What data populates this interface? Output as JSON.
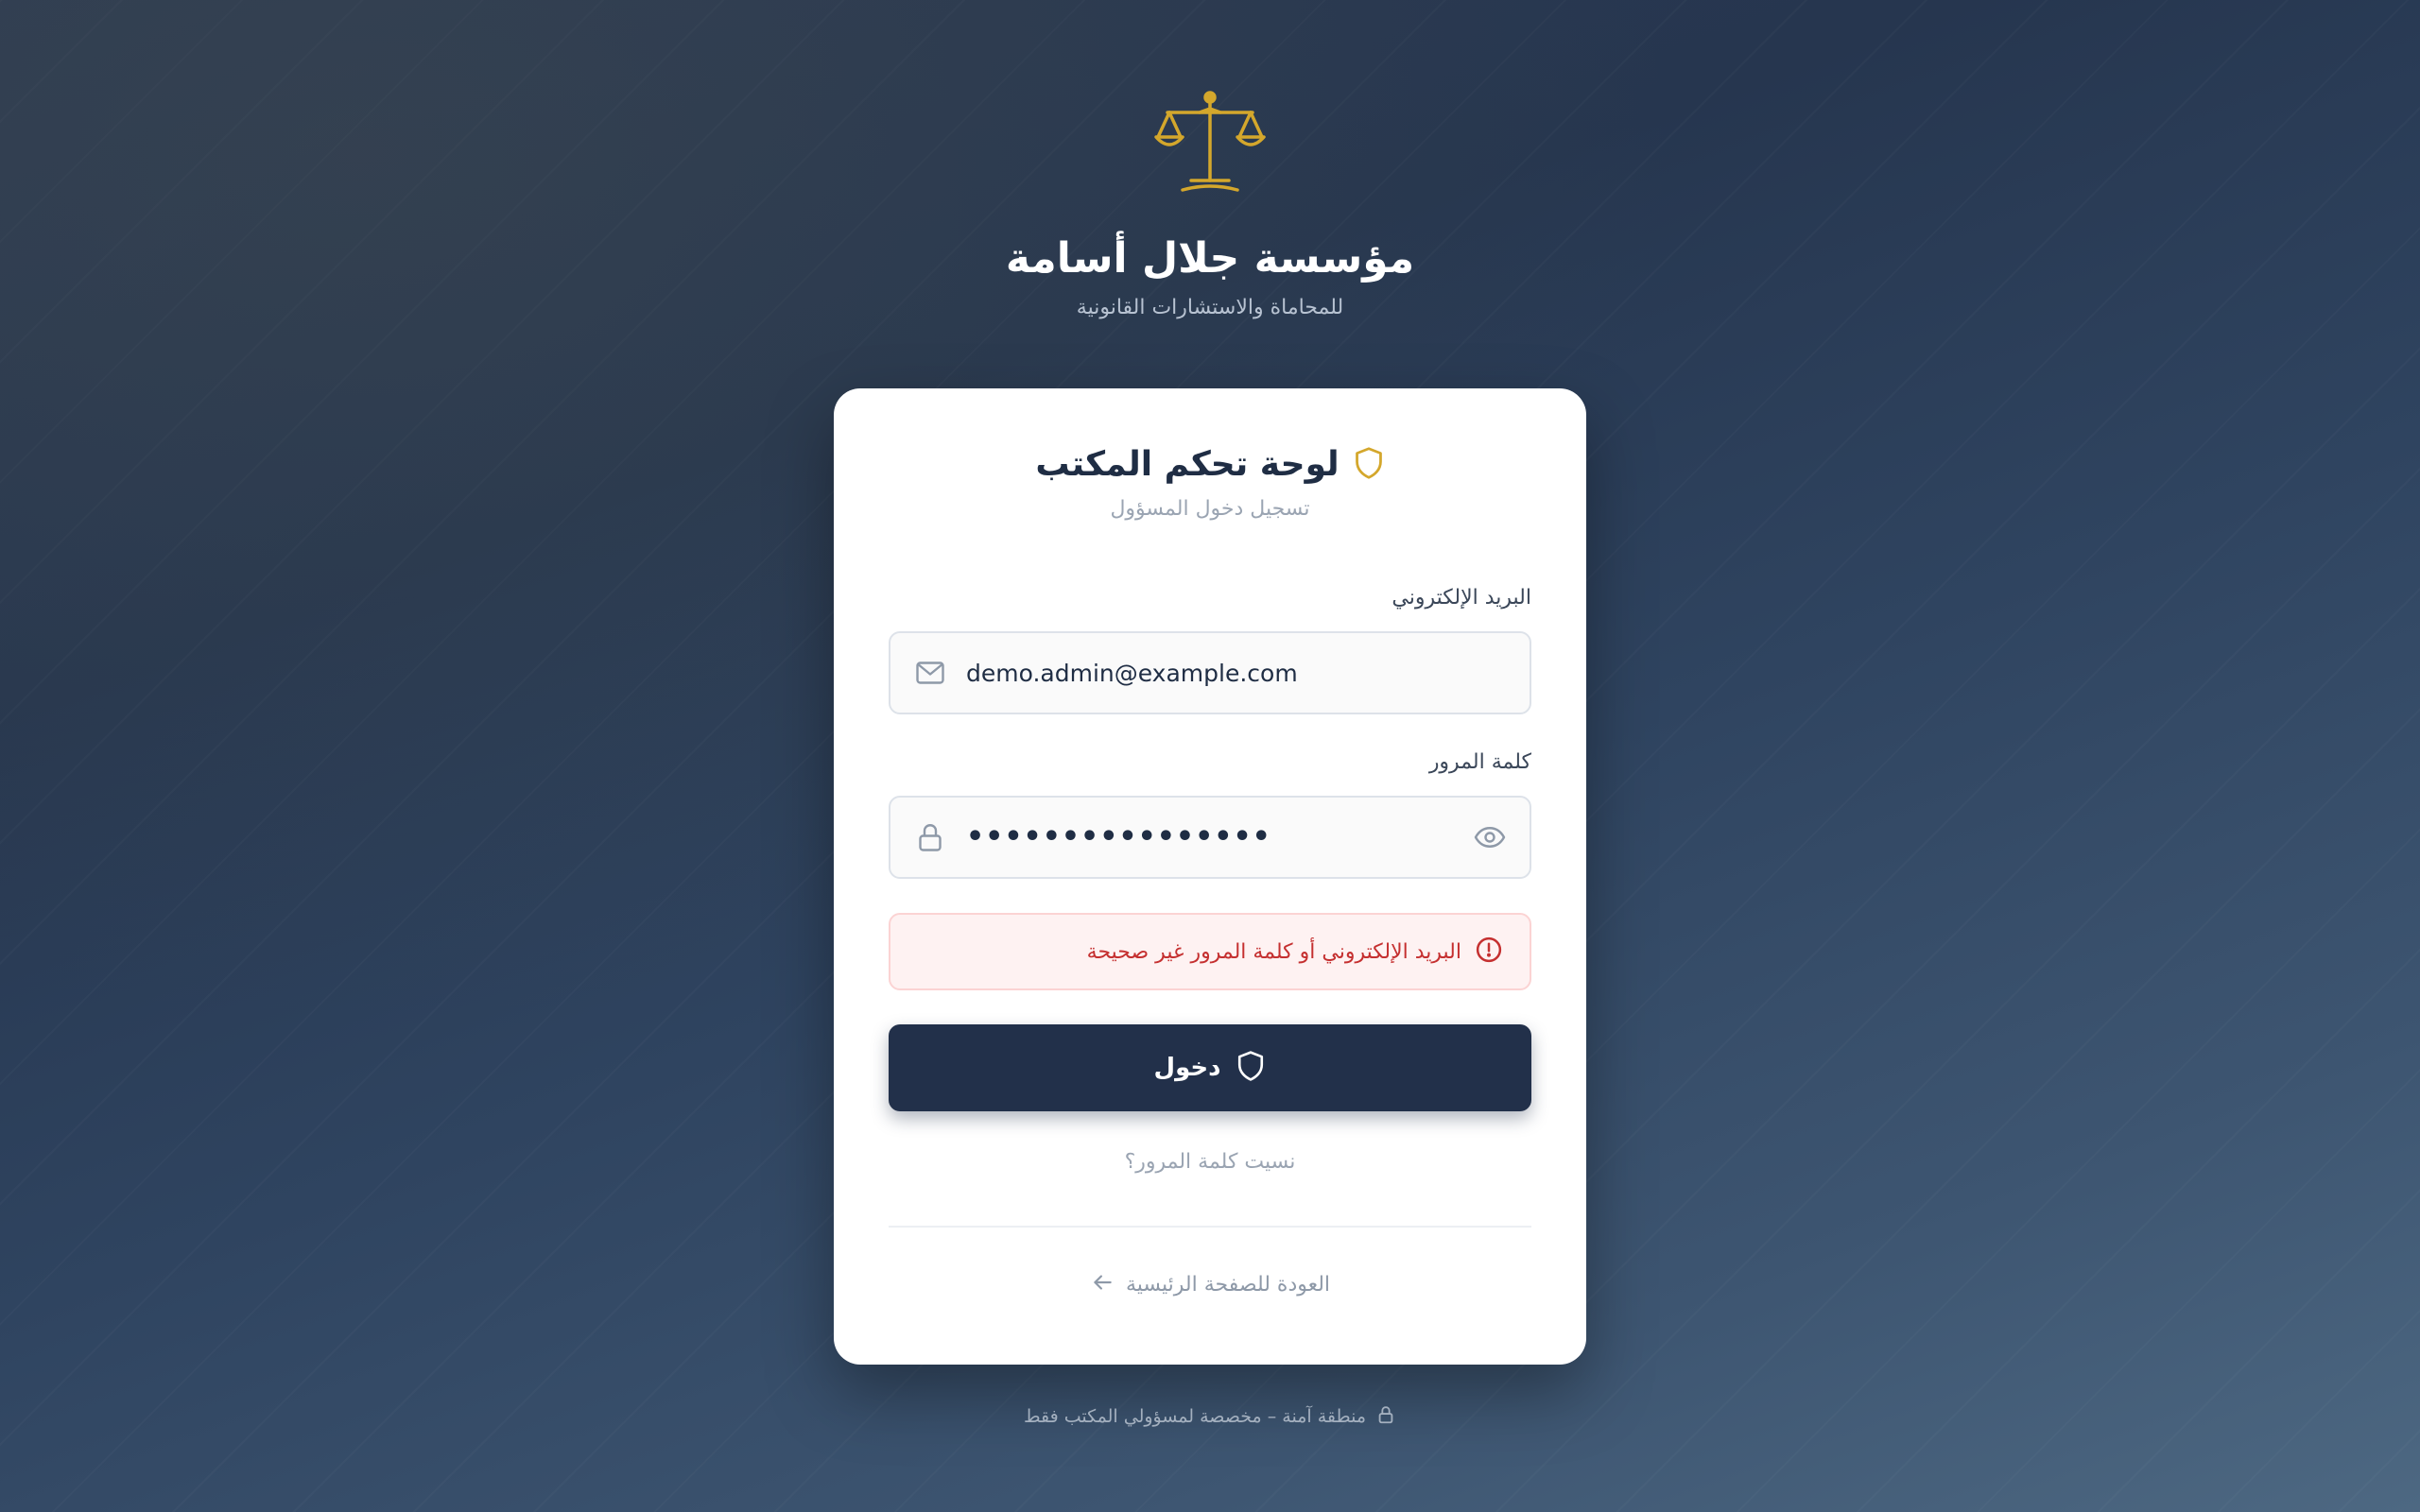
{
  "brand": {
    "logo_icon": "scales-of-justice-icon",
    "title": "مؤسسة جلال أسامة",
    "subtitle": "للمحاماة والاستشارات القانونية",
    "accent_color": "#d4a72c"
  },
  "login_card": {
    "title_icon": "shield-icon",
    "title": "لوحة تحكم المكتب",
    "subtitle": "تسجيل دخول المسؤول",
    "email": {
      "label": "البريد الإلكتروني",
      "value": "demo.admin@example.com",
      "icon": "mail-icon"
    },
    "password": {
      "label": "كلمة المرور",
      "masked_value": "••••••••••••••••",
      "icon": "lock-icon",
      "toggle_icon": "eye-icon"
    },
    "error": {
      "icon": "alert-circle-icon",
      "message": "البريد الإلكتروني أو كلمة المرور غير صحيحة",
      "color": "#c53030"
    },
    "submit": {
      "label": "دخول",
      "icon": "shield-icon",
      "color": "#22304a"
    },
    "forgot_password": "نسيت كلمة المرور؟",
    "back_home": {
      "label": "العودة للصفحة الرئيسية",
      "icon": "arrow-left-icon"
    }
  },
  "footer": {
    "icon": "lock-icon",
    "text": "منطقة آمنة – مخصصة لمسؤولي المكتب فقط"
  }
}
